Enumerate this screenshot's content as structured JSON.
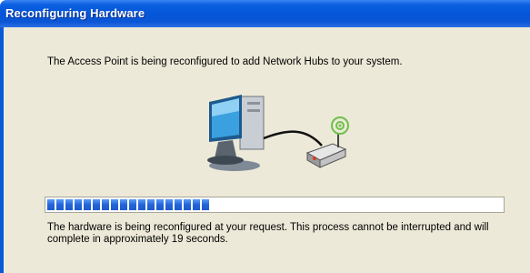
{
  "window": {
    "title": "Reconfiguring Hardware"
  },
  "message": "The Access Point is being reconfigured to add Network Hubs to your system.",
  "progress": {
    "fraction": 0.37,
    "color": "#2364d8"
  },
  "status": {
    "text": "The hardware is being reconfigured at your request.  This process cannot be interrupted and will complete in approximately 19 seconds."
  },
  "illustration": {
    "icons": [
      "computer-icon",
      "access-point-icon",
      "wireless-signal-icon"
    ]
  }
}
